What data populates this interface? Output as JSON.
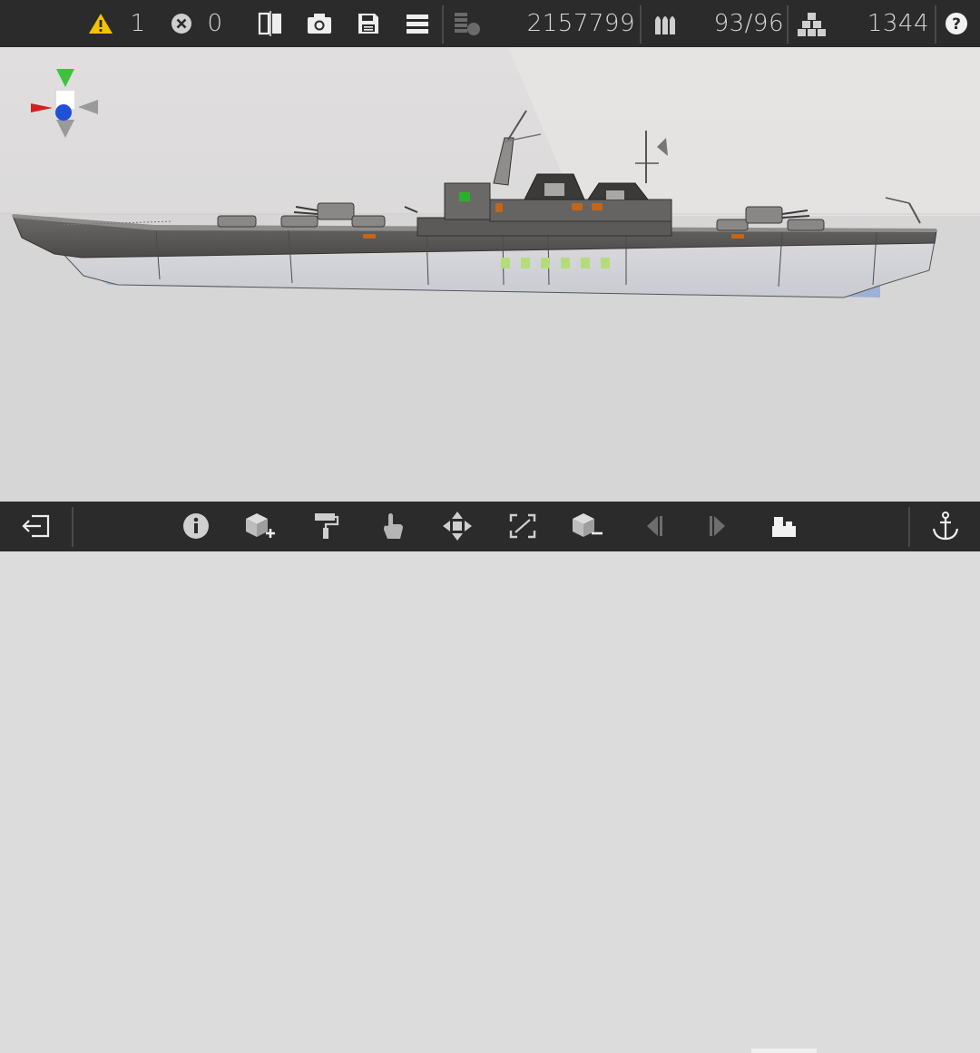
{
  "toolbar": {
    "warnings_count": "1",
    "errors_count": "0",
    "cost_value": "2157799",
    "ammo_value": "93/96",
    "parts_value": "1344"
  },
  "icons": {
    "warning": "warning-triangle-icon",
    "error": "error-circle-icon",
    "mirror": "mirror-split-icon",
    "camera": "camera-icon",
    "save": "save-disk-icon",
    "menu": "hamburger-menu-icon",
    "cost": "coin-stack-icon",
    "ammo": "ammo-shells-icon",
    "parts": "cube-pile-icon",
    "help": "help-icon",
    "exit": "exit-icon",
    "info": "info-icon",
    "add_part": "add-part-icon",
    "paint": "paint-roller-icon",
    "select": "touch-hand-icon",
    "move": "move-arrows-icon",
    "resize": "resize-icon",
    "remove_part": "remove-part-icon",
    "prev": "previous-icon",
    "next": "next-icon",
    "view": "view-mode-icon",
    "anchor": "anchor-icon"
  },
  "colors": {
    "toolbar_bg": "#2b2b2b",
    "warning_yellow": "#f2c200",
    "gizmo_x": "#d42020",
    "gizmo_y": "#3ec23e",
    "gizmo_z": "#2050d8"
  }
}
